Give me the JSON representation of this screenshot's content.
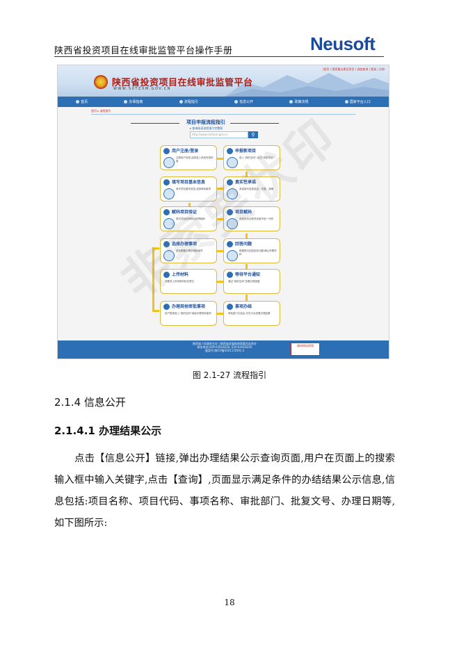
{
  "header": {
    "title": "陕西省投资项目在线审批监管平台操作手册",
    "logo": "Neusoft"
  },
  "screenshot": {
    "top_links": "|首页 | 国家重点建设项目 | 进度查询 | 登录 | 注册",
    "site_title": "陕西省投资项目在线审批监管平台",
    "site_url": "WWW.SXTZXM.GOV.CN",
    "nav_items": [
      "首页",
      "办事指南",
      "流程指引",
      "信息公开",
      "政策法规",
      "国家平台入口"
    ],
    "breadcrumb": "首页 ▸ 流程指引",
    "flow_title": "项目申报流程指引",
    "search_hint": "▸ 查询阅读流程指引完整版",
    "search_placeholder": "http://www.sxtzxm.gov.cn",
    "steps": [
      {
        "title": "用户注册/登录",
        "text": "注册用户信息,选择进入系统完成申报"
      },
      {
        "title": "申报新项目",
        "text": "进入“我的空间”,点击“申报项目”"
      },
      {
        "title": "填写项目基本信息",
        "text": "填写项目基本信息,选择审批事项"
      },
      {
        "title": "真实性承诺",
        "text": "承诺填写信息真实、完整、准确"
      },
      {
        "title": "赋码项目验证",
        "text": "提交项目经审核后获得赋码"
      },
      {
        "title": "项目赋码",
        "text": "系统自动为新项目赋予统一代码"
      },
      {
        "title": "选择办理事项",
        "text": "选择需要办理的审批事项"
      },
      {
        "title": "回答问题",
        "text": "根据提示回答相关问题,确认所需材料"
      },
      {
        "title": "上传材料",
        "text": "按要求上传申报材料并提交"
      },
      {
        "title": "等待平台通知",
        "text": "通过“我的空间”查看办理进度"
      },
      {
        "title": "办理其他审批事项",
        "text": "用户登录进入“我的空间”继续办理其他事项"
      },
      {
        "title": "事项办结",
        "text": "审批部门办结后,可在平台查看办理结果"
      }
    ],
    "footer_lines": [
      "陕西省人民政府主办 | 陕西省发展和改革委员会承办",
      "联系电话:029-63918226, 029-63918226",
      "备案号:陕ICP备05011700号-3"
    ],
    "badge": "政府网站找错"
  },
  "caption": "图 2.1-27  流程指引",
  "section": {
    "h3": "2.1.4 信息公开",
    "h4": "2.1.4.1 办理结果公示",
    "paragraph": "点击【信息公开】链接,弹出办理结果公示查询页面,用户在页面上的搜索输入框中输入关键字,点击【查询】,页面显示满足条件的办结结果公示信息,信息包括:项目名称、项目代码、事项名称、审批部门、批复文号、办理日期等,如下图所示:"
  },
  "watermark": "非索要状印",
  "page_number": "18"
}
